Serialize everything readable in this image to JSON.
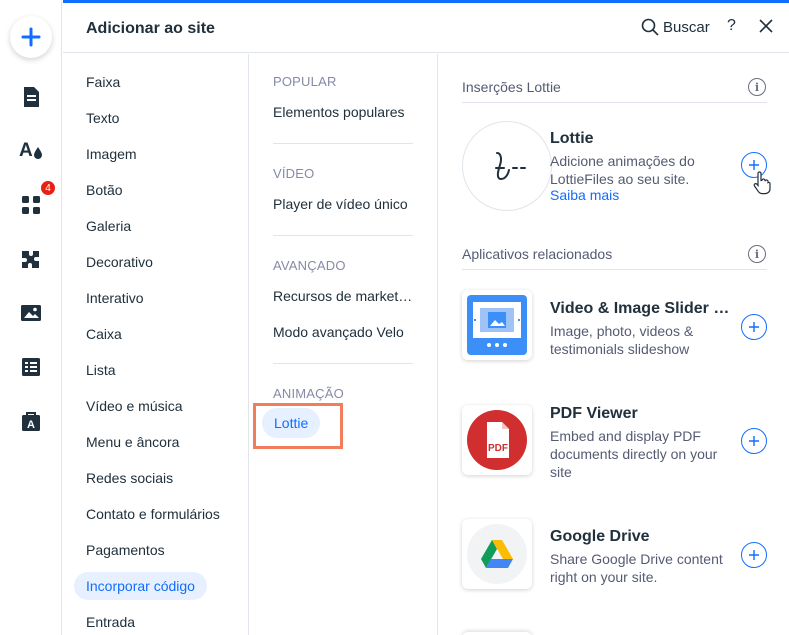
{
  "rail": {
    "badge_count": "4",
    "accent": "#116dff"
  },
  "header": {
    "title": "Adicionar ao site",
    "search_label": "Buscar",
    "help_label": "?"
  },
  "categories": [
    "Faixa",
    "Texto",
    "Imagem",
    "Botão",
    "Galeria",
    "Decorativo",
    "Interativo",
    "Caixa",
    "Lista",
    "Vídeo e música",
    "Menu e âncora",
    "Redes sociais",
    "Contato e formulários",
    "Pagamentos",
    "Incorporar código",
    "Entrada"
  ],
  "active_category": "Incorporar código",
  "subcategories": {
    "popular_title": "POPULAR",
    "popular_items": [
      "Elementos populares"
    ],
    "video_title": "VÍDEO",
    "video_items": [
      "Player de vídeo único"
    ],
    "advanced_title": "AVANÇADO",
    "advanced_items": [
      "Recursos de marketing",
      "Modo avançado Velo"
    ],
    "animation_title": "ANIMAÇÃO",
    "animation_items": [
      "Lottie"
    ]
  },
  "content": {
    "lottie_section_title": "Inserções Lottie",
    "lottie": {
      "name": "Lottie",
      "description": "Adicione animações do LottieFiles ao seu site.",
      "learn_more": "Saiba mais"
    },
    "related_section_title": "Aplicativos relacionados",
    "apps": [
      {
        "name": "Video & Image Slider & Carousel",
        "description": "Image, photo, videos & testimonials slideshow",
        "icon": "video-slider-icon"
      },
      {
        "name": "PDF Viewer",
        "description": "Embed and display PDF documents directly on your site",
        "icon": "pdf-icon"
      },
      {
        "name": "Google Drive",
        "description": "Share Google Drive content right on your site.",
        "icon": "google-drive-icon"
      }
    ]
  }
}
